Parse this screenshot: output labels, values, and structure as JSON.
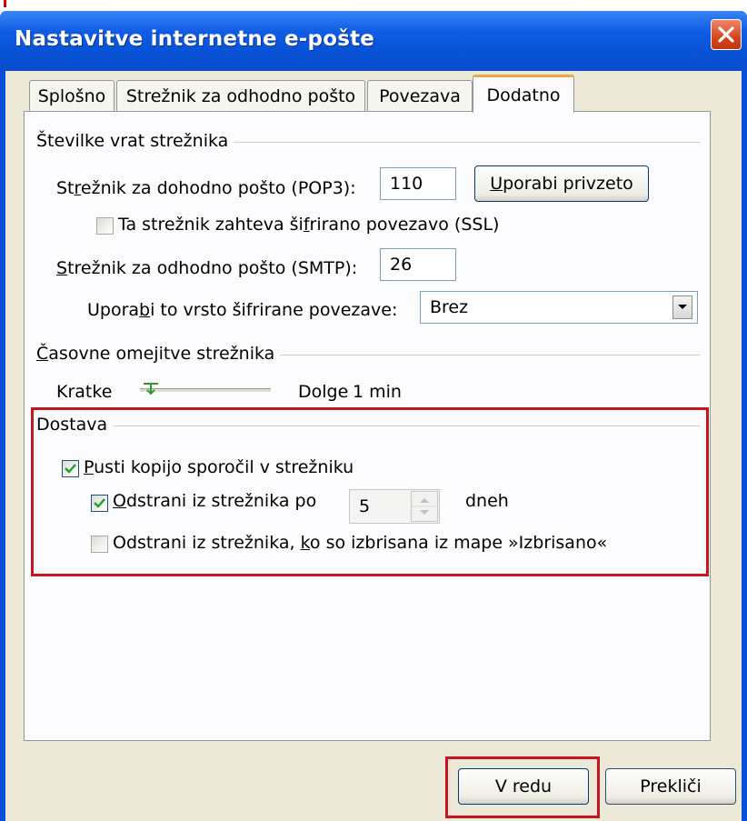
{
  "window": {
    "title": "Nastavitve internetne e-pošte"
  },
  "tabs": [
    {
      "label": "Splošno"
    },
    {
      "label": "Strežnik za odhodno pošto"
    },
    {
      "label": "Povezava"
    },
    {
      "label": "Dodatno"
    }
  ],
  "ports": {
    "group_label": "Številke vrat strežnika",
    "incoming_label_pre": "St",
    "incoming_label_ul": "r",
    "incoming_label_post": "ežnik za dohodno pošto (POP3):",
    "incoming_value": "110",
    "default_pre": "",
    "default_ul": "U",
    "default_post": "porabi privzeto",
    "ssl_pre": "Ta strežnik zahteva ši",
    "ssl_ul": "f",
    "ssl_post": "rirano povezavo (SSL)",
    "ssl_checked": false,
    "outgoing_label_pre": "",
    "outgoing_label_ul": "S",
    "outgoing_label_post": "trežnik za odhodno pošto (SMTP):",
    "outgoing_value": "26",
    "enc_label_pre": "Upora",
    "enc_label_ul": "b",
    "enc_label_post": "i to vrsto šifrirane povezave:",
    "enc_value": "Brez"
  },
  "timeouts": {
    "group_label_ul": "Č",
    "group_label_post": "asovne omejitve strežnika",
    "short_label": "Kratke",
    "long_label": "Dolge",
    "value": "1 min"
  },
  "delivery": {
    "group_label": "Dostava",
    "leave_copy_ul": "P",
    "leave_copy_post": "usti kopijo sporočil v strežniku",
    "leave_copy_checked": true,
    "remove_after_ul": "O",
    "remove_after_post": "dstrani iz strežnika po",
    "remove_after_checked": true,
    "days_value": "5",
    "days_unit": "dneh",
    "remove_deleted_pre": "Odstrani iz strežnika, ",
    "remove_deleted_ul": "k",
    "remove_deleted_post": "o so izbrisana iz mape »Izbrisano«",
    "remove_deleted_checked": false
  },
  "buttons": {
    "ok": "V redu",
    "cancel": "Prekliči"
  },
  "colors": {
    "highlight": "#c8141e",
    "titlebar": "#0752d6"
  }
}
